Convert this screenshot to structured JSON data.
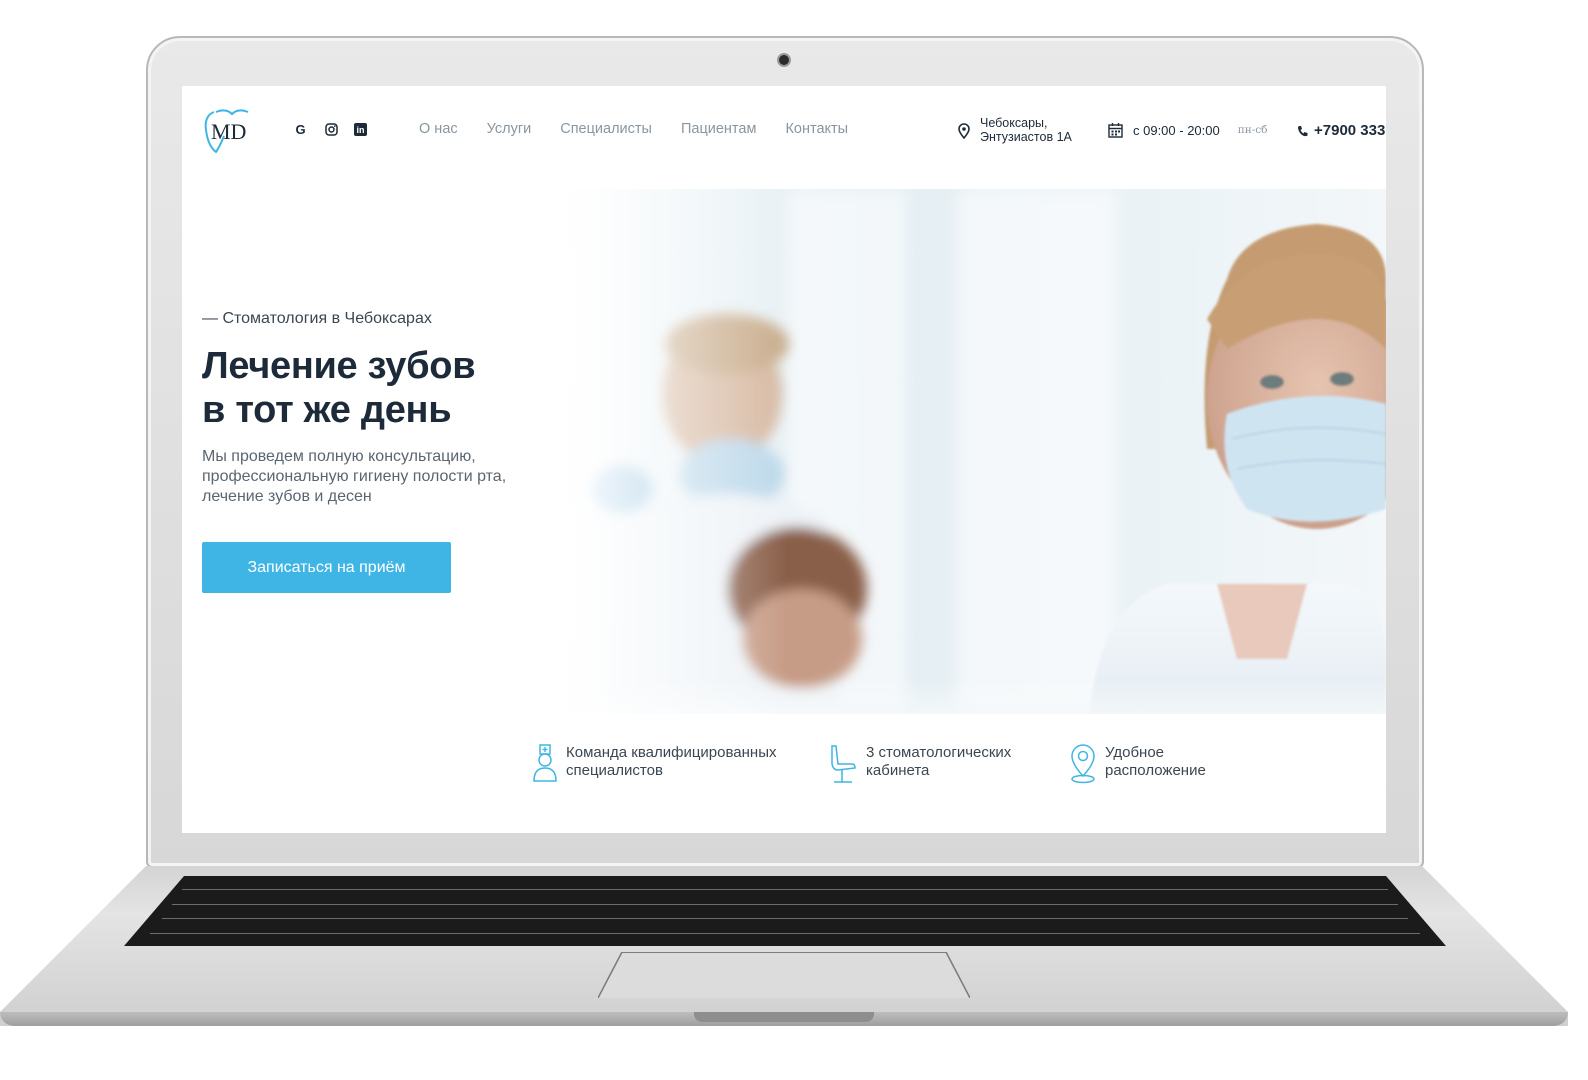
{
  "header": {
    "logo_text": "MD",
    "socials": [
      {
        "icon": "google-icon",
        "glyph": "G"
      },
      {
        "icon": "instagram-icon",
        "glyph": ""
      },
      {
        "icon": "linkedin-icon",
        "glyph": "in"
      }
    ],
    "nav": [
      "О нас",
      "Услуги",
      "Специалисты",
      "Пациентам",
      "Контакты"
    ],
    "address": {
      "line1": "Чебоксары,",
      "line2": "Энтузиастов 1А",
      "icon": "location-pin-icon"
    },
    "hours": {
      "time": "с 09:00 - 20:00",
      "days": "пн-сб",
      "icon": "calendar-icon"
    },
    "phone": {
      "number": "+7900 333",
      "icon": "phone-icon"
    }
  },
  "hero": {
    "eyebrow": "— Стоматология в Чебоксарах",
    "title_line1": "Лечение зубов",
    "title_line2": "в тот же день",
    "desc_line1": "Мы проведем полную консультацию,",
    "desc_line2": "профессиональную гигиену полости рта,",
    "desc_line3": "лечение зубов и десен",
    "cta": "Записаться на приём"
  },
  "features": [
    {
      "icon": "dentist-icon",
      "line1": "Команда квалифицированных",
      "line2": "специалистов"
    },
    {
      "icon": "dental-chair-icon",
      "line1": "3 стоматологических",
      "line2": "кабинета"
    },
    {
      "icon": "map-pin-icon",
      "line1": "Удобное",
      "line2": "расположение"
    }
  ],
  "colors": {
    "accent": "#3eb5e5",
    "dark": "#1d2a3a",
    "nav": "#8b95a1"
  }
}
